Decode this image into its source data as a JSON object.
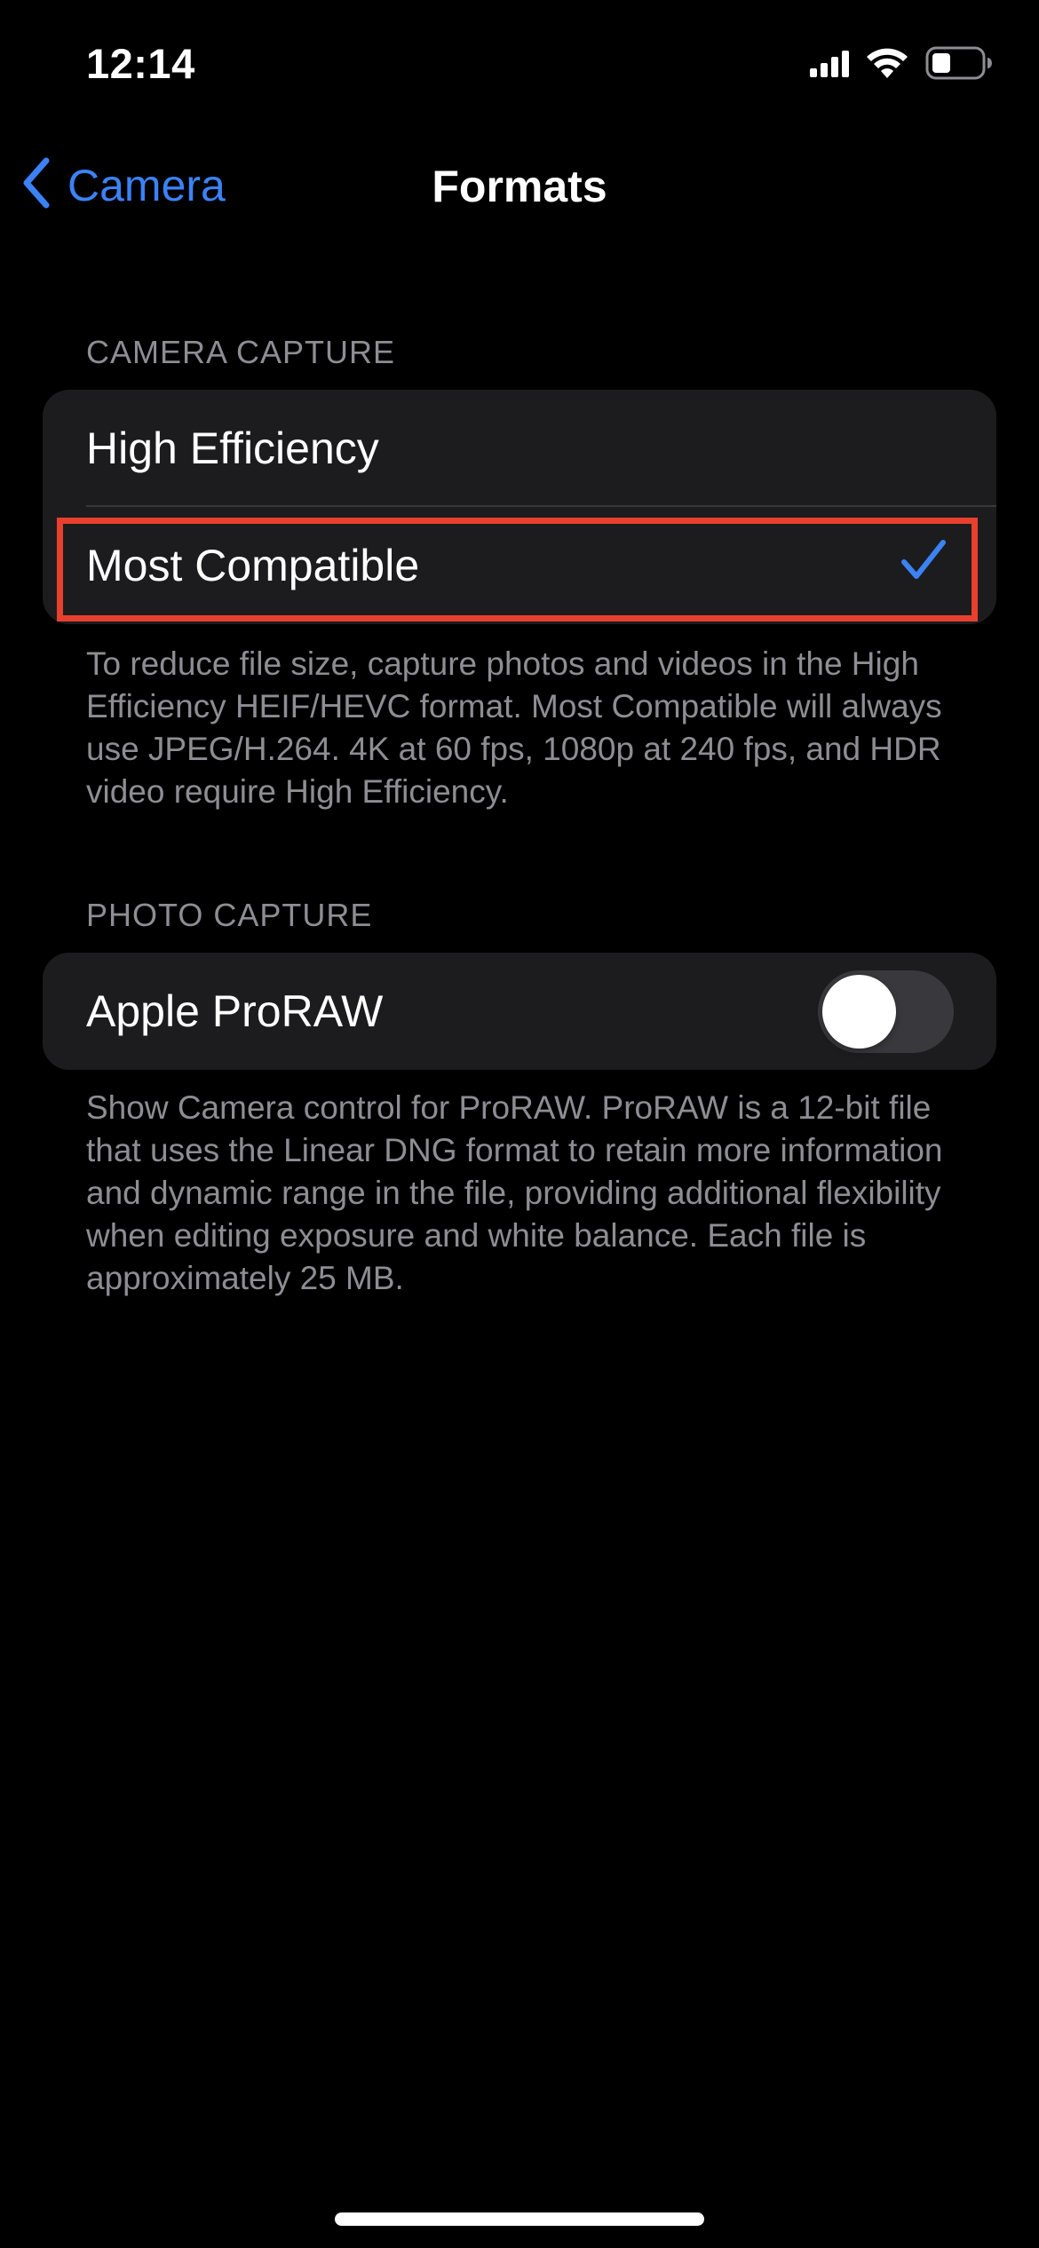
{
  "status_bar": {
    "time": "12:14",
    "icons": [
      "cellular-signal-icon",
      "wifi-icon",
      "battery-icon"
    ]
  },
  "nav": {
    "back_label": "Camera",
    "title": "Formats"
  },
  "camera_capture": {
    "header": "CAMERA CAPTURE",
    "options": [
      {
        "label": "High Efficiency",
        "selected": false
      },
      {
        "label": "Most Compatible",
        "selected": true
      }
    ],
    "footer": "To reduce file size, capture photos and videos in the High Efficiency HEIF/HEVC format. Most Compatible will always use JPEG/H.264. 4K at 60 fps, 1080p at 240 fps, and HDR video require High Efficiency."
  },
  "photo_capture": {
    "header": "PHOTO CAPTURE",
    "proraw_label": "Apple ProRAW",
    "proraw_on": false,
    "footer": "Show Camera control for ProRAW. ProRAW is a 12-bit file that uses the Linear DNG format to retain more information and dynamic range in the file, providing additional flexibility when editing exposure and white balance. Each file is approximately 25 MB."
  },
  "colors": {
    "accent": "#3b82f6",
    "highlight": "#e8402d",
    "background": "#000000",
    "group_background": "#1c1c1e",
    "secondary_text": "#8d8d93"
  }
}
